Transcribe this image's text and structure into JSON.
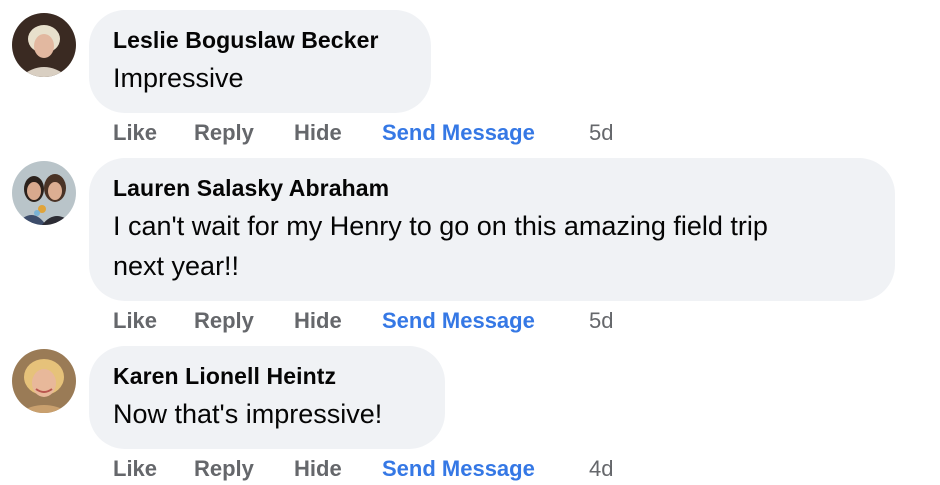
{
  "actions": {
    "like": "Like",
    "reply": "Reply",
    "hide": "Hide",
    "send_message": "Send Message"
  },
  "comments": [
    {
      "author": "Leslie Boguslaw Becker",
      "text": "Impressive",
      "time": "5d"
    },
    {
      "author": "Lauren Salasky Abraham",
      "text_lines": [
        "I can't wait for my Henry to go on this amazing field trip",
        "next year!!"
      ],
      "time": "5d"
    },
    {
      "author": "Karen Lionell Heintz",
      "text": "Now that's impressive!",
      "time": "4d"
    }
  ],
  "colors": {
    "bubble": "#f0f2f5",
    "action_gray": "#65676b",
    "link_blue": "#3578e5",
    "text": "#050505"
  }
}
